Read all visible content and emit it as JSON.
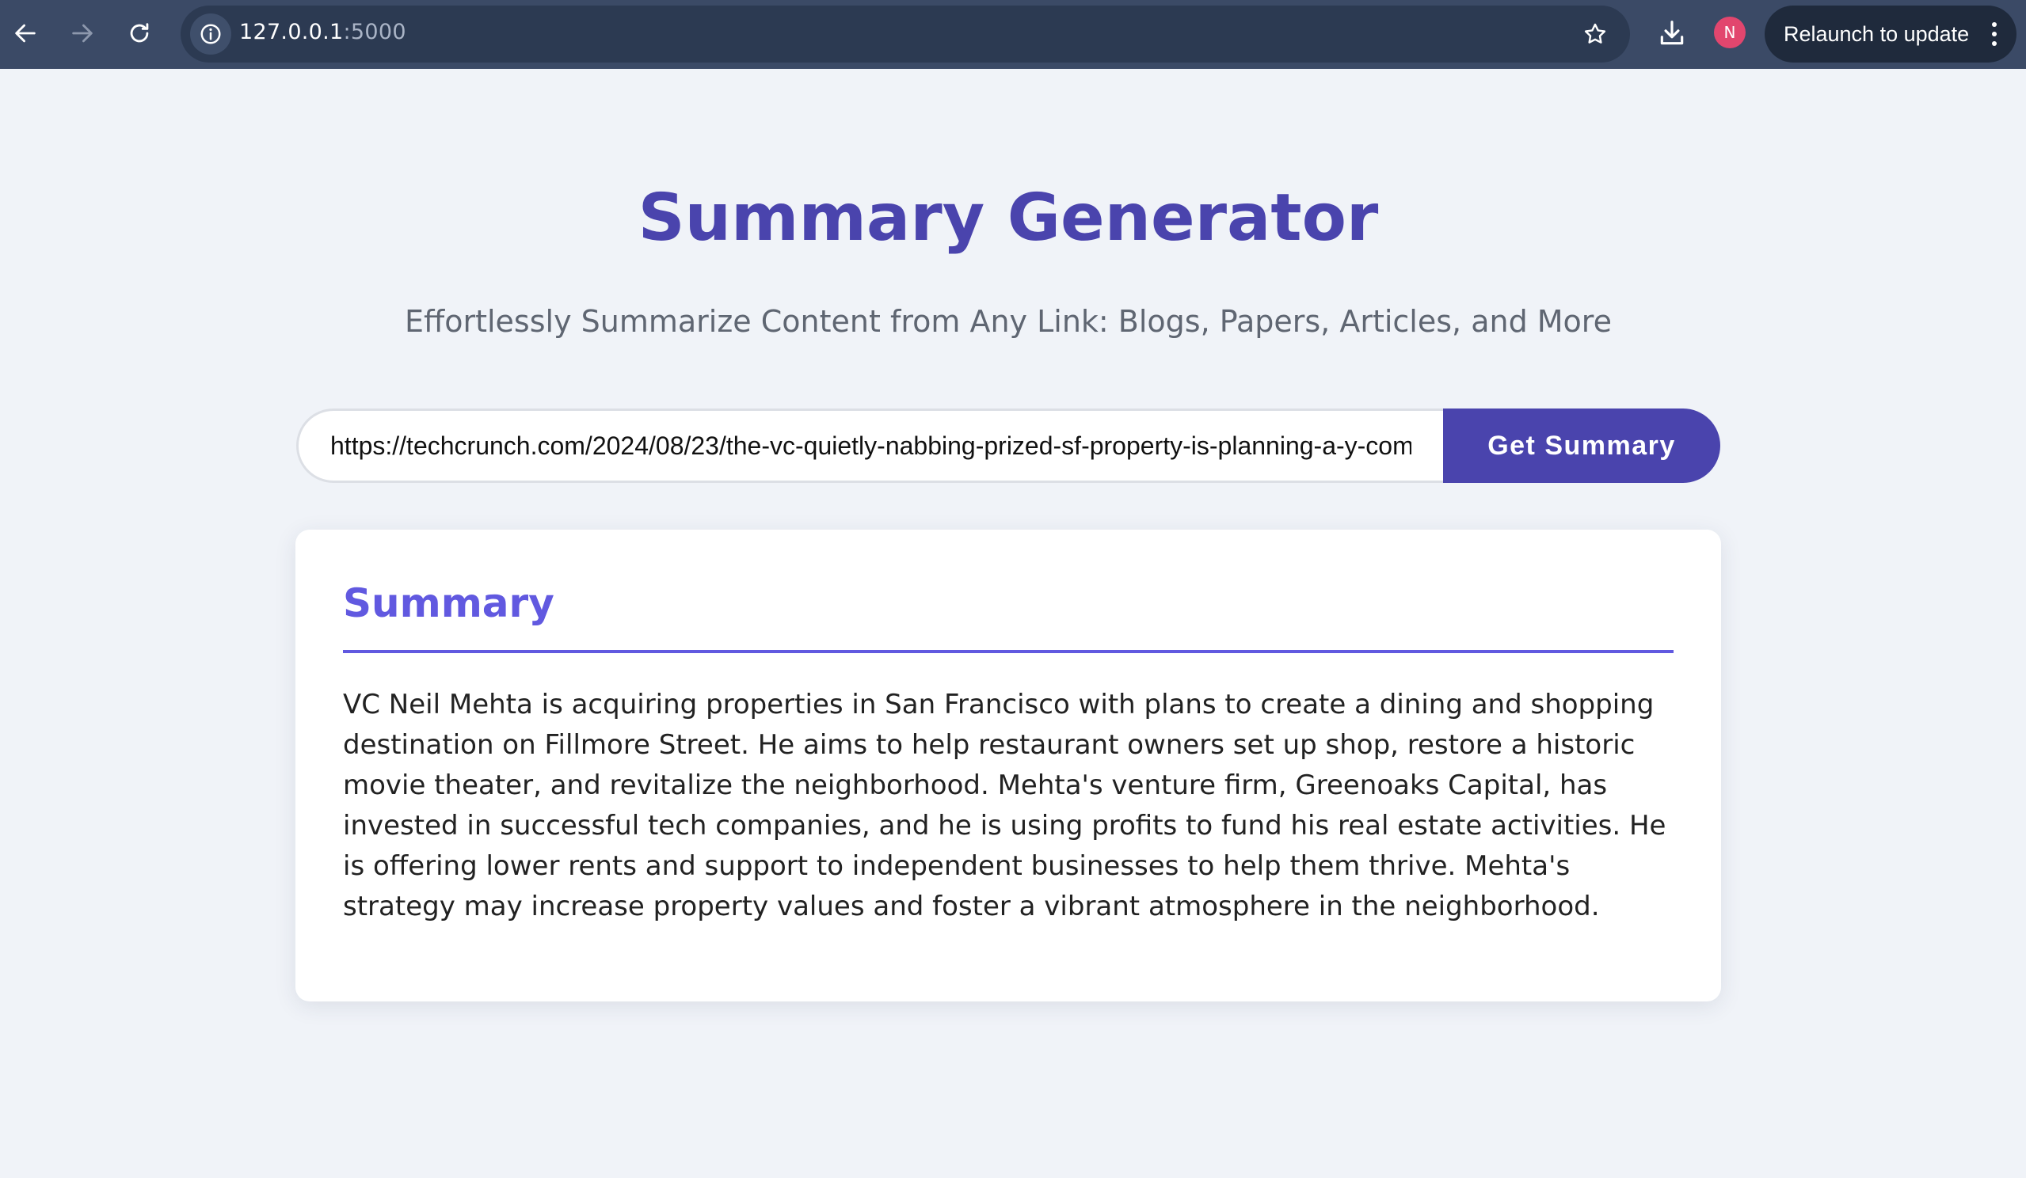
{
  "browser": {
    "url_host": "127.0.0.1",
    "url_port": ":5000",
    "profile_initial": "N",
    "relaunch_label": "Relaunch to update",
    "icons": {
      "back": "back-arrow-icon",
      "forward": "forward-arrow-icon",
      "reload": "reload-icon",
      "site_info": "info-icon",
      "bookmark": "star-icon",
      "download": "download-icon",
      "menu": "kebab-menu-icon"
    }
  },
  "page": {
    "title": "Summary Generator",
    "subtitle": "Effortlessly Summarize Content from Any Link: Blogs, Papers, Articles, and More",
    "url_input_value": "https://techcrunch.com/2024/08/23/the-vc-quietly-nabbing-prized-sf-property-is-planning-a-y-com",
    "submit_label": "Get Summary",
    "summary": {
      "heading": "Summary",
      "text": "VC Neil Mehta is acquiring properties in San Francisco with plans to create a dining and shopping destination on Fillmore Street. He aims to help restaurant owners set up shop, restore a historic movie theater, and revitalize the neighborhood. Mehta's venture firm, Greenoaks Capital, has invested in successful tech companies, and he is using profits to fund his real estate activities. He is offering lower rents and support to independent businesses to help them thrive. Mehta's strategy may increase property values and foster a vibrant atmosphere in the neighborhood."
    }
  },
  "colors": {
    "chrome_bg": "#3b4a66",
    "page_bg": "#f0f3f8",
    "title": "#4a44ad",
    "button": "#4a44ad",
    "summary_accent": "#6159e0",
    "avatar": "#e2466e"
  }
}
